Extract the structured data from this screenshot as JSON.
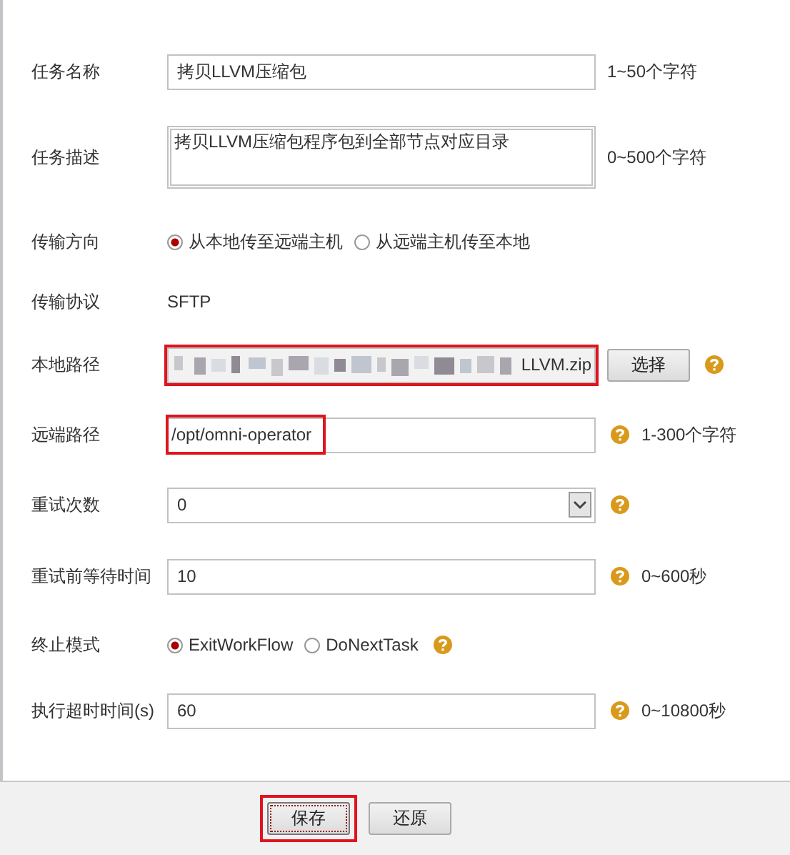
{
  "form": {
    "rows": [
      {
        "kind": "text",
        "label": "任务名称",
        "value": "拷贝LLVM压缩包",
        "help": false,
        "hint": "1~50个字符",
        "highlighted": false
      },
      {
        "kind": "textarea",
        "label": "任务描述",
        "value": "拷贝LLVM压缩包程序包到全部节点对应目录",
        "help": false,
        "hint": "0~500个字符"
      },
      {
        "kind": "radio",
        "label": "传输方向",
        "help": false,
        "options": [
          {
            "label": "从本地传至远端主机",
            "selected": true
          },
          {
            "label": "从远端主机传至本地",
            "selected": false
          }
        ]
      },
      {
        "kind": "static",
        "label": "传输协议",
        "value": "SFTP"
      },
      {
        "kind": "file",
        "label": "本地路径",
        "value": "LLVM.zip",
        "button": "选择",
        "help": true,
        "highlighted": true
      },
      {
        "kind": "text",
        "label": "远端路径",
        "value": "/opt/omni-operator",
        "help": true,
        "hint": "1-300个字符",
        "highlighted": true
      },
      {
        "kind": "select",
        "label": "重试次数",
        "value": "0",
        "help": true
      },
      {
        "kind": "text",
        "label": "重试前等待时间",
        "value": "10",
        "help": true,
        "hint": "0~600秒",
        "highlighted": false
      },
      {
        "kind": "radio",
        "label": "终止模式",
        "help": true,
        "options": [
          {
            "label": "ExitWorkFlow",
            "selected": true
          },
          {
            "label": "DoNextTask",
            "selected": false
          }
        ]
      },
      {
        "kind": "text",
        "label": "执行超时时间(s)",
        "value": "60",
        "help": true,
        "hint": "0~10800秒",
        "highlighted": false
      }
    ]
  },
  "footer": {
    "buttons": [
      {
        "label": "保存",
        "highlighted": true
      },
      {
        "label": "还原",
        "highlighted": false
      }
    ]
  }
}
